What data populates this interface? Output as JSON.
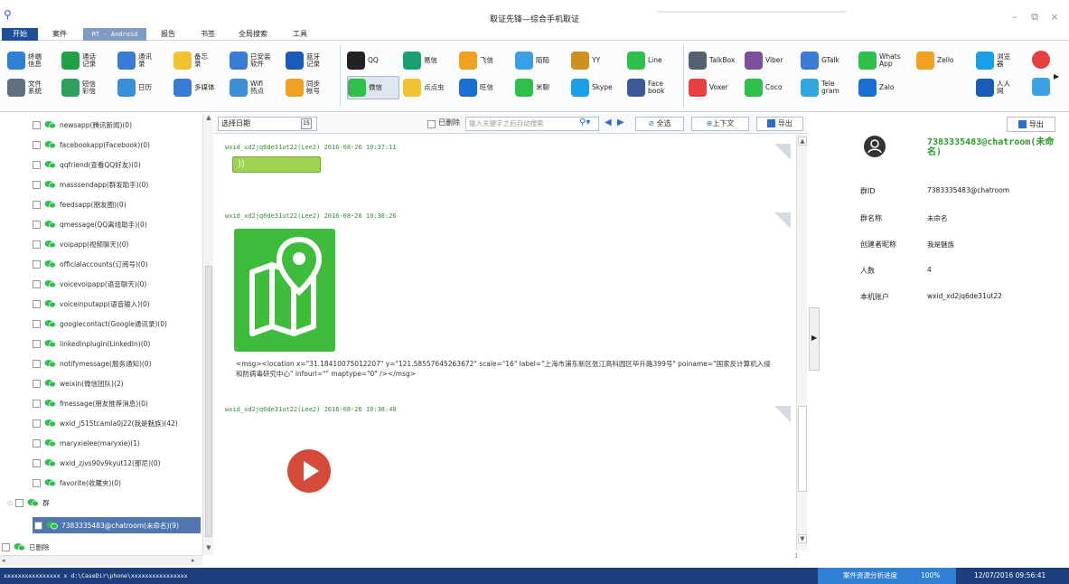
{
  "app": {
    "title": "取证先锋—综合手机取证"
  },
  "menu": [
    "开始",
    "案件",
    "RT - Android",
    "报告",
    "书签",
    "全局搜索",
    "工具"
  ],
  "ribbon": {
    "group1": [
      {
        "label": "终端\n信息",
        "icon": "phone-info-icon",
        "color": "#2f7fd4"
      },
      {
        "label": "通话\n记录",
        "icon": "call-log-icon",
        "color": "#22a046"
      },
      {
        "label": "通讯\n录",
        "icon": "contacts-icon",
        "color": "#3a7bd5"
      },
      {
        "label": "备忘\n录",
        "icon": "memo-icon",
        "color": "#f2c230"
      },
      {
        "label": "已安装\n软件",
        "icon": "apps-icon",
        "color": "#3a7bd5"
      },
      {
        "label": "蓝牙\n记录",
        "icon": "bluetooth-icon",
        "color": "#1a5bb8"
      },
      {
        "label": "文件\n系统",
        "icon": "filesystem-icon",
        "color": "#607080"
      },
      {
        "label": "短信\n彩信",
        "icon": "sms-icon",
        "color": "#2fa060"
      },
      {
        "label": "日历",
        "icon": "calendar-icon",
        "color": "#3a8fd8"
      },
      {
        "label": "多媒体",
        "icon": "media-icon",
        "color": "#3a7bd5"
      },
      {
        "label": "Wifi\n热点",
        "icon": "wifi-icon",
        "color": "#3a8fd8"
      },
      {
        "label": "同步\n帐号",
        "icon": "sync-icon",
        "color": "#f2a020"
      }
    ],
    "group2": [
      {
        "label": "QQ",
        "icon": "qq-icon",
        "color": "#222"
      },
      {
        "label": "易信",
        "icon": "yixin-icon",
        "color": "#1aa070"
      },
      {
        "label": "飞信",
        "icon": "fetion-icon",
        "color": "#f2a020"
      },
      {
        "label": "陌陌",
        "icon": "momo-icon",
        "color": "#3a9ee8"
      },
      {
        "label": "YY",
        "icon": "yy-icon",
        "color": "#d09020"
      },
      {
        "label": "Line",
        "icon": "line-icon",
        "color": "#2ec04a"
      },
      {
        "label": "微信",
        "icon": "wechat-icon",
        "color": "#2ec04a"
      },
      {
        "label": "点点虫",
        "icon": "diandianchong-icon",
        "color": "#f2c230"
      },
      {
        "label": "旺信",
        "icon": "wangxin-icon",
        "color": "#1a6fd0"
      },
      {
        "label": "米聊",
        "icon": "miliao-icon",
        "color": "#2ec04a"
      },
      {
        "label": "Skype",
        "icon": "skype-icon",
        "color": "#1a9ee8"
      },
      {
        "label": "Face\nbook",
        "icon": "facebook-icon",
        "color": "#3b5998"
      }
    ],
    "group3": [
      {
        "label": "TalkBox",
        "icon": "talkbox-icon",
        "color": "#556070"
      },
      {
        "label": "Viber",
        "icon": "viber-icon",
        "color": "#7b519d"
      },
      {
        "label": "GTalk",
        "icon": "gtalk-icon",
        "color": "#3a7bd5"
      },
      {
        "label": "Whats\nApp",
        "icon": "whatsapp-icon",
        "color": "#2ec04a"
      },
      {
        "label": "Zello",
        "icon": "zello-icon",
        "color": "#f2a020"
      },
      {
        "label": "浏览\n器",
        "icon": "browser-icon",
        "color": "#1a9ee8"
      },
      {
        "label": "Voxer",
        "icon": "voxer-icon",
        "color": "#e84040"
      },
      {
        "label": "Coco",
        "icon": "coco-icon",
        "color": "#2ec04a"
      },
      {
        "label": "Tele\ngram",
        "icon": "telegram-icon",
        "color": "#2ea6e0"
      },
      {
        "label": "Zalo",
        "icon": "zalo-icon",
        "color": "#1a6fd0"
      },
      {
        "label": "人人\n网",
        "icon": "renren-icon",
        "color": "#1a5bb8"
      }
    ]
  },
  "tree": {
    "items": [
      "newsapp(腾讯新闻)(0)",
      "facebookapp(Facebook)(0)",
      "qqfriend(查看QQ好友)(0)",
      "masssendapp(群发助手)(0)",
      "feedsapp(朋友圈)(0)",
      "qmessage(QQ离线助手)(0)",
      "voipapp(视频聊天)(0)",
      "officialaccounts(订阅号)(0)",
      "voicevoipapp(语音聊天)(0)",
      "voiceinputapp(语音输入)(0)",
      "googlecontact(Google通讯录)(0)",
      "linkedinplugin(LinkedIn)(0)",
      "notifymessage(服务通知)(0)",
      "weixin(微信团队)(2)",
      "fmessage(朋友推荐消息)(0)",
      "wxid_j515tcamia0j22(我是魅族)(42)",
      "maryxielee(maryxie)(1)",
      "wxid_zjvs90v9kyut12(那尼)(0)",
      "favorite(收藏夹)(0)"
    ],
    "group_label": "群",
    "selected_item": "7383335483@chatroom(未命名)(9)",
    "deleted_label": "已删除"
  },
  "toolbar": {
    "date_placeholder": "选择日期",
    "deleted_checkbox": "已删除",
    "search_placeholder": "输入关键字之后自动搜索",
    "select_all": "全选",
    "context": "上下文",
    "export": "导出"
  },
  "messages": [
    {
      "header": "wxid_xd2jq6de31ut22(Lee2) 2016-08-26 10:37:11",
      "type": "voice"
    },
    {
      "header": "wxid_xd2jq6de31ut22(Lee2) 2016-08-26 10:38:26",
      "type": "location",
      "text": "<msg><location x=\"31.18410075012207\" y=\"121.58557645263672\" scale=\"16\" label=\"上海市浦东新区张江高科园区毕升路399号\" poiname=\"国家反计算机入侵和防病毒研究中心\" infourl=\"\" maptype=\"0\" /></msg>"
    },
    {
      "header": "wxid_xd2jq6de31ut22(Lee2) 2016-08-26 10:38:40",
      "type": "video"
    }
  ],
  "detail": {
    "export": "导出",
    "name": "7383335483@chatroom(未命名)",
    "rows": [
      {
        "k": "群ID",
        "v": "7383335483@chatroom"
      },
      {
        "k": "群名称",
        "v": "未命名"
      },
      {
        "k": "创建者昵称",
        "v": "我是魅族"
      },
      {
        "k": "人数",
        "v": "4"
      },
      {
        "k": "本机账户",
        "v": "wxid_xd2jq6de31ut22"
      }
    ]
  },
  "status": {
    "left": "xxxxxxxxxxxxxxxx x   d:\\CaseDir\\phone\\xxxxxxxxxxxxxxxx",
    "progress_label": "案件资源分析进度",
    "progress": "100%",
    "datetime": "12/07/2016 09:56:41"
  },
  "chat_page_marker": "1"
}
